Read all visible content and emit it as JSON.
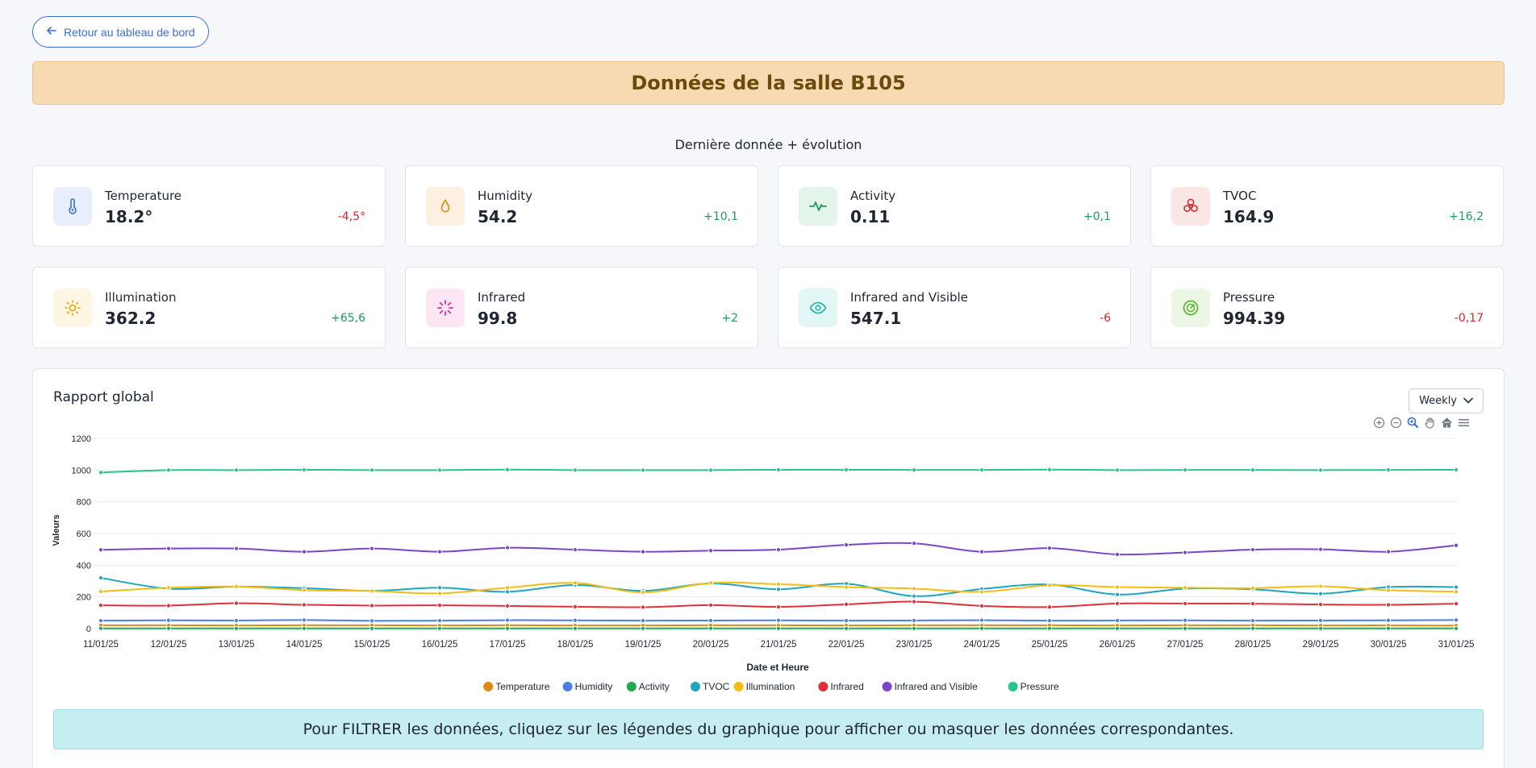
{
  "nav": {
    "back_label": "Retour au tableau de bord"
  },
  "banner": {
    "title": "Données de la salle B105"
  },
  "section_title": "Dernière donnée + évolution",
  "cards": [
    {
      "label": "Temperature",
      "value": "18.2°",
      "delta": "-4,5°",
      "trend": "neg",
      "icon": "thermometer-icon",
      "color": "#3b6fe0",
      "bg": "#e7eefc"
    },
    {
      "label": "Humidity",
      "value": "54.2",
      "delta": "+10,1",
      "trend": "pos",
      "icon": "droplet-icon",
      "color": "#e08a12",
      "bg": "#fdf0e1"
    },
    {
      "label": "Activity",
      "value": "0.11",
      "delta": "+0,1",
      "trend": "pos",
      "icon": "activity-icon",
      "color": "#1f9a5b",
      "bg": "#e3f4ea"
    },
    {
      "label": "TVOC",
      "value": "164.9",
      "delta": "+16,2",
      "trend": "pos",
      "icon": "biohazard-icon",
      "color": "#d7262b",
      "bg": "#fbe6e6"
    },
    {
      "label": "Illumination",
      "value": "362.2",
      "delta": "+65,6",
      "trend": "pos",
      "icon": "sun-icon",
      "color": "#e0a812",
      "bg": "#fdf6e3"
    },
    {
      "label": "Infrared",
      "value": "99.8",
      "delta": "+2",
      "trend": "pos",
      "icon": "loader-icon",
      "color": "#d62f9b",
      "bg": "#fce6f4"
    },
    {
      "label": "Infrared and Visible",
      "value": "547.1",
      "delta": "-6",
      "trend": "neg",
      "icon": "eye-icon",
      "color": "#1ab3a5",
      "bg": "#e2f7f5"
    },
    {
      "label": "Pressure",
      "value": "994.39",
      "delta": "-0,17",
      "trend": "neg",
      "icon": "gauge-icon",
      "color": "#5cb82f",
      "bg": "#ebf7e4"
    }
  ],
  "report": {
    "title": "Rapport global",
    "period": "Weekly",
    "hint": "Pour FILTRER les données, cliquez sur les légendes du graphique pour afficher ou masquer les données correspondantes."
  },
  "toolbar_icons": [
    "zoom-in-icon",
    "zoom-out-icon",
    "zoom-select-icon",
    "pan-hand-icon",
    "home-reset-icon",
    "menu-icon"
  ],
  "chart_data": {
    "type": "line",
    "xlabel": "Date et Heure",
    "ylabel": "Valeurs",
    "ylim": [
      0,
      1200
    ],
    "yticks": [
      0,
      200,
      400,
      600,
      800,
      1000,
      1200
    ],
    "grid": true,
    "legend_position": "bottom",
    "categories": [
      "11/01/25",
      "12/01/25",
      "13/01/25",
      "14/01/25",
      "15/01/25",
      "16/01/25",
      "17/01/25",
      "18/01/25",
      "19/01/25",
      "20/01/25",
      "21/01/25",
      "22/01/25",
      "23/01/25",
      "24/01/25",
      "25/01/25",
      "26/01/25",
      "27/01/25",
      "28/01/25",
      "29/01/25",
      "30/01/25",
      "31/01/25"
    ],
    "series": [
      {
        "name": "Temperature",
        "color": "#e08a12",
        "values": [
          21,
          21,
          20,
          21,
          21,
          20,
          21,
          20,
          20,
          21,
          21,
          20,
          21,
          21,
          21,
          20,
          21,
          21,
          20,
          20,
          19
        ]
      },
      {
        "name": "Humidity",
        "color": "#4a7fe8",
        "values": [
          50,
          52,
          51,
          54,
          49,
          50,
          53,
          52,
          50,
          51,
          52,
          50,
          51,
          53,
          50,
          51,
          52,
          50,
          51,
          52,
          54
        ]
      },
      {
        "name": "Activity",
        "color": "#1faa4b",
        "values": [
          1,
          1,
          1,
          1,
          1,
          1,
          1,
          1,
          1,
          1,
          1,
          1,
          1,
          1,
          1,
          1,
          1,
          1,
          1,
          1,
          1
        ]
      },
      {
        "name": "TVOC",
        "color": "#1ea5bf",
        "values": [
          320,
          252,
          265,
          255,
          238,
          258,
          232,
          275,
          238,
          285,
          248,
          283,
          205,
          250,
          278,
          215,
          252,
          248,
          220,
          262,
          262
        ]
      },
      {
        "name": "Illumination",
        "color": "#f5bd11",
        "values": [
          234,
          258,
          265,
          243,
          237,
          222,
          258,
          288,
          228,
          288,
          280,
          262,
          252,
          232,
          273,
          262,
          258,
          255,
          267,
          242,
          233
        ]
      },
      {
        "name": "Infrared",
        "color": "#e0303a",
        "values": [
          147,
          145,
          160,
          150,
          145,
          147,
          143,
          138,
          135,
          148,
          137,
          153,
          170,
          143,
          136,
          158,
          158,
          157,
          152,
          150,
          157
        ]
      },
      {
        "name": "Infrared and Visible",
        "color": "#7b45c9",
        "values": [
          497,
          505,
          505,
          485,
          505,
          485,
          510,
          498,
          485,
          492,
          498,
          528,
          538,
          485,
          508,
          468,
          480,
          498,
          500,
          485,
          525
        ]
      },
      {
        "name": "Pressure",
        "color": "#27c48d",
        "values": [
          985,
          1000,
          1000,
          1002,
          1000,
          1000,
          1003,
          1000,
          1000,
          1000,
          1002,
          1002,
          1001,
          1001,
          1003,
          1000,
          1001,
          1001,
          1000,
          1001,
          1002
        ]
      }
    ]
  }
}
